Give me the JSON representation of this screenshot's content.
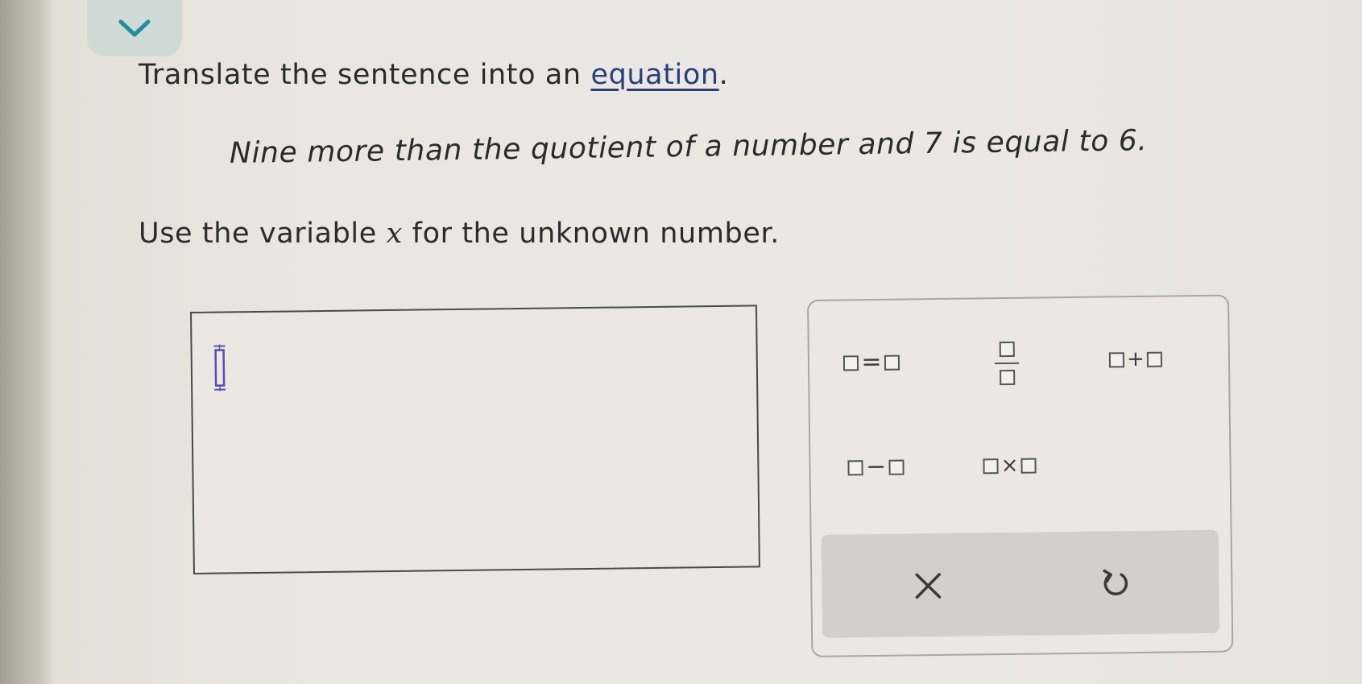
{
  "question": {
    "prompt_prefix": "Translate the sentence into an ",
    "prompt_link": "equation",
    "prompt_suffix": ".",
    "sentence": "Nine more than the quotient of a number and 7 is equal to 6.",
    "instruction_prefix": "Use the variable ",
    "instruction_variable": "x",
    "instruction_suffix": " for the unknown number."
  },
  "answer": {
    "value": ""
  },
  "keypad": {
    "keys": [
      {
        "name": "equals",
        "operator": "="
      },
      {
        "name": "fraction",
        "operator": ""
      },
      {
        "name": "plus",
        "operator": "+"
      },
      {
        "name": "minus",
        "operator": "−"
      },
      {
        "name": "times",
        "operator": "×"
      }
    ],
    "actions": [
      {
        "name": "clear",
        "icon": "close-icon"
      },
      {
        "name": "undo",
        "icon": "undo-icon"
      }
    ]
  },
  "colors": {
    "link": "#2a3f78",
    "tab": "#cfd9d6",
    "chevron": "#1f8f9c",
    "action_bar": "#d2d0cb",
    "cursor": "#5b4bb8"
  }
}
